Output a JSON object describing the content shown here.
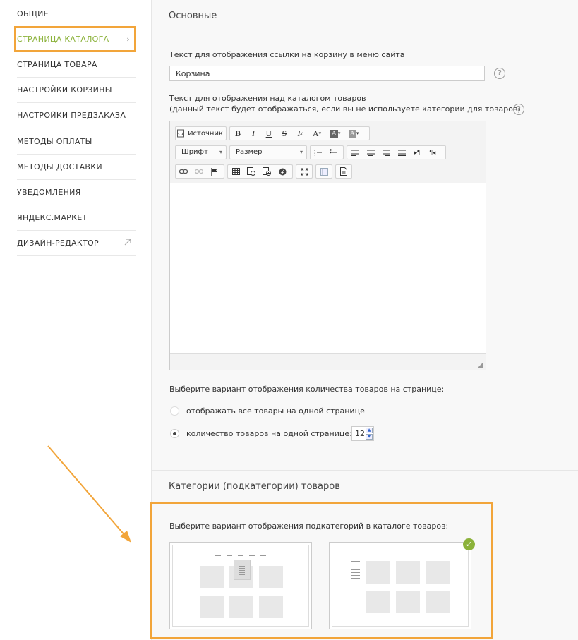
{
  "sidebar": {
    "items": [
      {
        "label": "ОБЩИЕ"
      },
      {
        "label": "СТРАНИЦА КАТАЛОГА"
      },
      {
        "label": "СТРАНИЦА ТОВАРА"
      },
      {
        "label": "НАСТРОЙКИ КОРЗИНЫ"
      },
      {
        "label": "НАСТРОЙКИ ПРЕДЗАКАЗА"
      },
      {
        "label": "МЕТОДЫ ОПЛАТЫ"
      },
      {
        "label": "МЕТОДЫ ДОСТАВКИ"
      },
      {
        "label": "УВЕДОМЛЕНИЯ"
      },
      {
        "label": "ЯНДЕКС.МАРКЕТ"
      },
      {
        "label": "ДИЗАЙН-РЕДАКТОР"
      }
    ],
    "active_color": "#8bb23a",
    "highlight_color": "#f2a53a"
  },
  "main": {
    "section_basic": "Основные",
    "cart_link_label": "Текст для отображения ссылки на корзину в меню сайта",
    "cart_link_value": "Корзина",
    "catalog_text_label": "Текст для отображения над каталогом товаров",
    "catalog_text_note": "(данный текст будет отображаться, если вы не используете категории для товаров)",
    "help_glyph": "?",
    "editor": {
      "source_label": "Источник",
      "font_label": "Шрифт",
      "size_label": "Размер"
    },
    "count_label": "Выберите вариант отображения количества товаров на странице:",
    "radio_all": "отображать все товары на одной странице",
    "radio_count": "количество товаров на одной странице:",
    "count_value": "12",
    "section_categories": "Категории (подкатегории) товаров",
    "subcat_label": "Выберите вариант отображения подкатегорий в каталоге товаров:",
    "check_glyph": "✓"
  }
}
